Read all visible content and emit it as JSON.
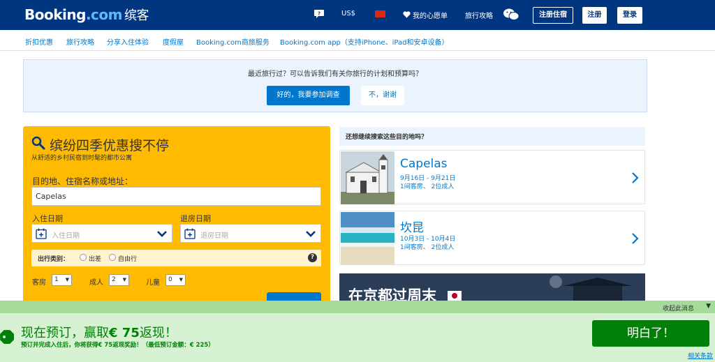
{
  "header": {
    "logo_brand": "Booking",
    "logo_dot": ".com",
    "logo_cn": "缤客",
    "currency": "US$",
    "wishlist": "我的心愿单",
    "trip_guide": "旅行攻略",
    "register_property": "注册住宿",
    "register": "注册",
    "login": "登录",
    "colors": {
      "brand": "#003580",
      "accent": "#febb02",
      "link": "#0077cc"
    }
  },
  "nav": {
    "items": [
      "折扣优惠",
      "旅行攻略",
      "分享入住体验",
      "度假屋",
      "Booking.com商旅服务",
      "Booking.com app（支持iPhone、iPad和安卓设备）"
    ]
  },
  "survey": {
    "question": "最近旅行过？可以告诉我们有关你旅行的计划和预算吗？",
    "yes": "好的，我要参加调查",
    "no": "不，谢谢"
  },
  "search": {
    "title": "缤纷四季优惠搜不停",
    "subtitle": "从舒适的乡村民宿到时髦的都市公寓",
    "destination_label": "目的地、住宿名称或地址：",
    "destination_value": "Capelas",
    "checkin_label": "入住日期",
    "checkin_placeholder": "入住日期",
    "checkout_label": "退房日期",
    "checkout_placeholder": "退房日期",
    "trip_type_label": "出行类别：",
    "trip_business": "出差",
    "trip_leisure": "自由行",
    "help": "?",
    "rooms_label": "客房",
    "rooms_value": "1",
    "adults_label": "成人",
    "adults_value": "2",
    "children_label": "儿童",
    "children_value": "0"
  },
  "recent": {
    "heading": "还想继续搜索这些目的地吗？",
    "cards": [
      {
        "name": "Capelas",
        "dates": "9月16日 - 9月21日",
        "guests": "1间客房、 2位成人"
      },
      {
        "name": "坎昆",
        "dates": "10月3日 - 10月4日",
        "guests": "1间客房、 2位成人"
      }
    ],
    "promo_title": "在京都过周末"
  },
  "notice": {
    "collapse": "收起此消息",
    "collapse_arrow": "▼",
    "title_prefix": "现在预订，赢取",
    "title_amount": "€ 75",
    "title_suffix": "返现！",
    "subtitle": "预订并完成入住后，你将获得€ 75返现奖励！（最低预订金额：€ 225）",
    "button": "明白了！",
    "terms": "相关条款"
  }
}
